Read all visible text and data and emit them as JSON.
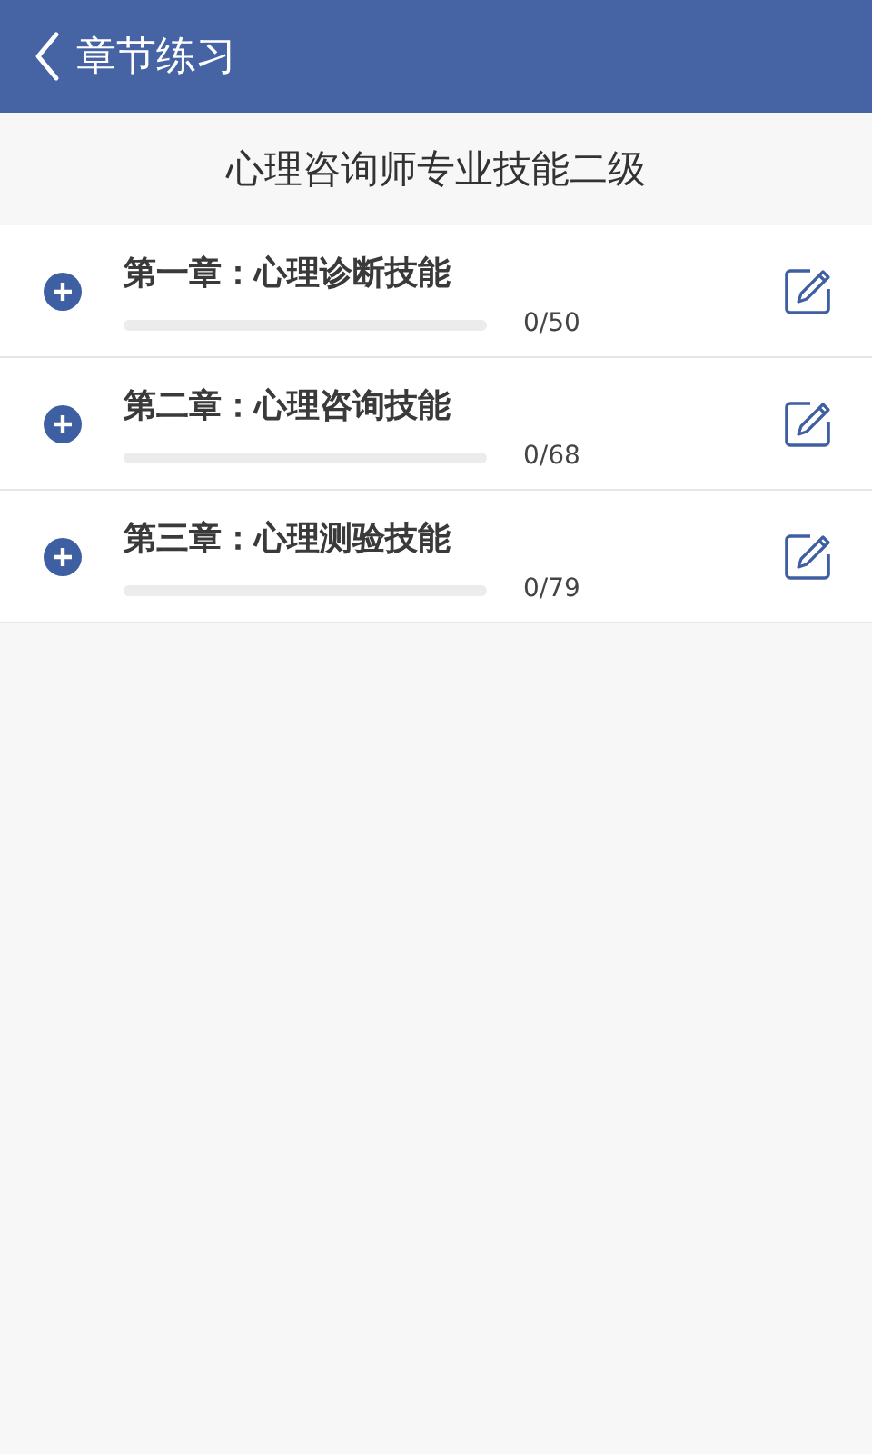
{
  "header": {
    "title": "章节练习"
  },
  "subject": {
    "title": "心理咨询师专业技能二级"
  },
  "chapters": [
    {
      "title": "第一章：心理诊断技能",
      "level": 0,
      "count": "0/50"
    },
    {
      "title": "第二章：心理咨询技能",
      "level": 0,
      "count": "0/68"
    },
    {
      "title": "第三章：心理测验技能",
      "level": 0,
      "count": "0/79"
    }
  ]
}
